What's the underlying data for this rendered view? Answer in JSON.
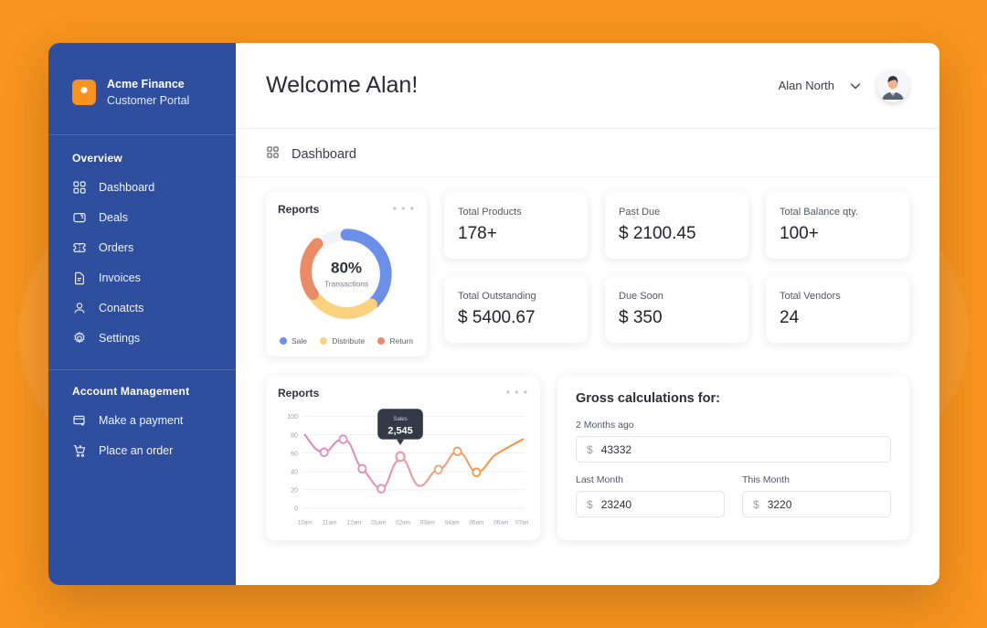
{
  "theme": {
    "page_background": "#F7931E",
    "sidebar_background": "#2F4E9E",
    "accent": "#F7931E",
    "card_background": "#FFFFFF"
  },
  "sidebar": {
    "brand": {
      "logo_icon": "square-dot-logo-icon",
      "name": "Acme Finance",
      "subtitle": "Customer Portal"
    },
    "sections": [
      {
        "title": "Overview",
        "items": [
          {
            "label": "Dashboard",
            "icon": "grid-icon"
          },
          {
            "label": "Deals",
            "icon": "wallet-icon"
          },
          {
            "label": "Orders",
            "icon": "ticket-icon"
          },
          {
            "label": "Invoices",
            "icon": "document-icon"
          },
          {
            "label": "Conatcts",
            "icon": "user-icon"
          },
          {
            "label": "Settings",
            "icon": "gear-icon"
          }
        ]
      },
      {
        "title": "Account Management",
        "items": [
          {
            "label": "Make a payment",
            "icon": "card-plus-icon"
          },
          {
            "label": "Place an order",
            "icon": "cart-icon"
          }
        ]
      }
    ]
  },
  "topbar": {
    "welcome": "Welcome Alan!",
    "user_name": "Alan North",
    "chevron_icon": "chevron-down-icon",
    "avatar_icon": "user-avatar"
  },
  "breadcrumb": {
    "icon": "grid-icon",
    "label": "Dashboard"
  },
  "stats": [
    {
      "label": "Total Products",
      "value": "178+"
    },
    {
      "label": "Past Due",
      "value": "$ 2100.45"
    },
    {
      "label": "Total Balance qty.",
      "value": "100+"
    },
    {
      "label": "Total Outstanding",
      "value": "$ 5400.67"
    },
    {
      "label": "Due Soon",
      "value": "$ 350"
    },
    {
      "label": "Total Vendors",
      "value": "24"
    }
  ],
  "gross": {
    "title": "Gross calculations for:",
    "fields": [
      {
        "label": "2 Months ago",
        "currency": "$",
        "value": "43332"
      },
      {
        "label": "Last Month",
        "currency": "$",
        "value": "23240"
      },
      {
        "label": "This Month",
        "currency": "$",
        "value": "3220"
      }
    ]
  },
  "chart_data": [
    {
      "id": "donut",
      "type": "pie",
      "title": "Reports",
      "menu_icon": "more-horizontal-icon",
      "center_value": "80%",
      "center_label": "Transactions",
      "categories": [
        "Sale",
        "Distribute",
        "Return"
      ],
      "values": [
        55,
        20,
        25
      ],
      "colors": [
        "#6C8FE8",
        "#FAD27E",
        "#E98B66"
      ],
      "legend": "bottom",
      "donut": true
    },
    {
      "id": "line",
      "type": "line",
      "title": "Reports",
      "menu_icon": "more-horizontal-icon",
      "xlabel": "",
      "ylabel": "",
      "ylim": [
        0,
        100
      ],
      "yticks": [
        0,
        20,
        40,
        60,
        80,
        100
      ],
      "grid": true,
      "x": [
        "10am",
        "11am",
        "12am",
        "01am",
        "02am",
        "03am",
        "04am",
        "05am",
        "06am",
        "07am"
      ],
      "series": [
        {
          "name": "Sales",
          "values": [
            80,
            62,
            75,
            43,
            22,
            56,
            42,
            63,
            39,
            63
          ],
          "color_start": "#D98BC0",
          "color_end": "#F0922F"
        }
      ],
      "markers_at": [
        1,
        2,
        3,
        4,
        5,
        6,
        7,
        8
      ],
      "tooltip": {
        "label": "Sales",
        "value": "2,545",
        "at_index": 5
      }
    }
  ]
}
